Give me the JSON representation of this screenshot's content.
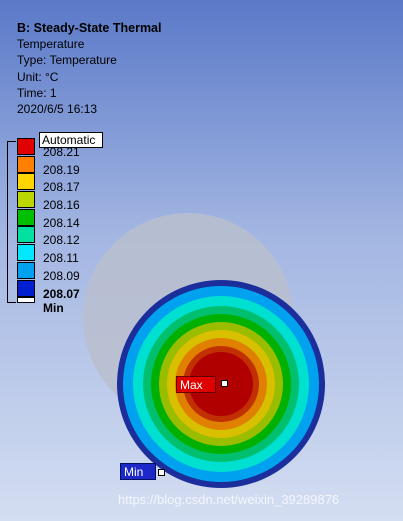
{
  "header": {
    "title": "B: Steady-State Thermal",
    "result_name": "Temperature",
    "type_line": "Type: Temperature",
    "unit_line": "Unit: °C",
    "time_line": "Time: 1",
    "date_line": "2020/6/5 16:13"
  },
  "legend": {
    "mode_label": "Automatic",
    "entries": [
      {
        "label": "208.21",
        "color": "#e00000"
      },
      {
        "label": "208.19",
        "color": "#ff8000"
      },
      {
        "label": "208.17",
        "color": "#ffd500"
      },
      {
        "label": "208.16",
        "color": "#bcd700"
      },
      {
        "label": "208.14",
        "color": "#00c000"
      },
      {
        "label": "208.12",
        "color": "#00e0a0"
      },
      {
        "label": "208.11",
        "color": "#00e8ff"
      },
      {
        "label": "208.09",
        "color": "#00a2f0"
      },
      {
        "label": "208.07 Min",
        "color": "#0020d0"
      }
    ]
  },
  "probes": {
    "max_label": "Max",
    "min_label": "Min"
  },
  "watermark": "https://blog.csdn.net/weixin_39289876"
}
